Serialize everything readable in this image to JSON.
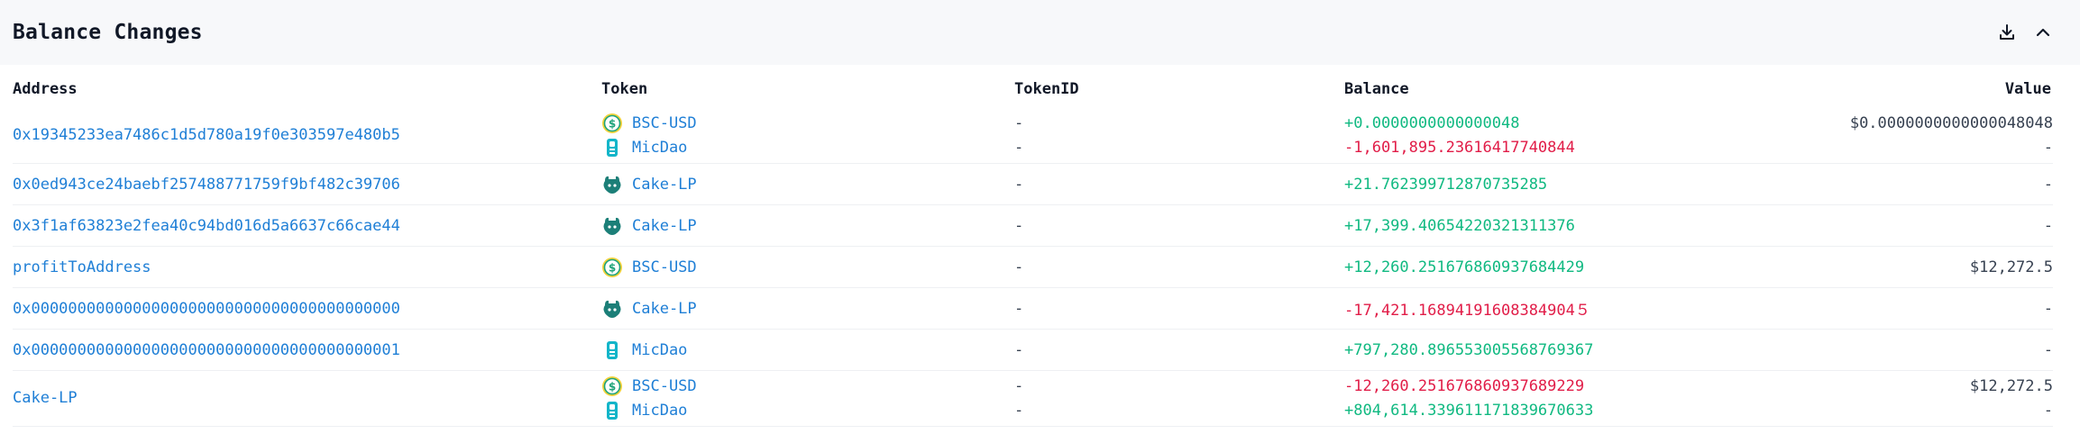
{
  "panel": {
    "title": "Balance Changes",
    "download_icon": "download-icon",
    "collapse_icon": "chevron-up-icon"
  },
  "columns": {
    "address": "Address",
    "token": "Token",
    "token_id": "TokenID",
    "balance": "Balance",
    "value": "Value"
  },
  "colors": {
    "link": "#1f7fd6",
    "positive": "#10b981",
    "negative": "#e11d48"
  },
  "rows": [
    {
      "address": "0x19345233ea7486c1d5d780a19f0e303597e480b5",
      "entries": [
        {
          "token": "BSC-USD",
          "icon": "bsc-usd-coin-icon",
          "token_id": "-",
          "balance": "+0.0000000000000048",
          "sign": "pos",
          "value": "$0.0000000000000048048"
        },
        {
          "token": "MicDao",
          "icon": "micdao-icon",
          "token_id": "-",
          "balance": "-1,601,895.23616417740844",
          "sign": "neg",
          "value": "-"
        }
      ]
    },
    {
      "address": "0x0ed943ce24baebf257488771759f9bf482c39706",
      "entries": [
        {
          "token": "Cake-LP",
          "icon": "cake-lp-icon",
          "token_id": "-",
          "balance": "+21.762399712870735285",
          "sign": "pos",
          "value": "-"
        }
      ]
    },
    {
      "address": "0x3f1af63823e2fea40c94bd016d5a6637c66cae44",
      "entries": [
        {
          "token": "Cake-LP",
          "icon": "cake-lp-icon",
          "token_id": "-",
          "balance": "+17,399.40654220321311376",
          "sign": "pos",
          "value": "-"
        }
      ]
    },
    {
      "address": "profitToAddress",
      "entries": [
        {
          "token": "BSC-USD",
          "icon": "bsc-usd-coin-icon",
          "token_id": "-",
          "balance": "+12,260.251676860937684429",
          "sign": "pos",
          "value": "$12,272.5"
        }
      ]
    },
    {
      "address": "0x0000000000000000000000000000000000000000",
      "entries": [
        {
          "token": "Cake-LP",
          "icon": "cake-lp-icon",
          "token_id": "-",
          "balance": "-17,421.16894191608384904５",
          "sign": "neg",
          "value": "-"
        }
      ]
    },
    {
      "address": "0x0000000000000000000000000000000000000001",
      "entries": [
        {
          "token": "MicDao",
          "icon": "micdao-icon",
          "token_id": "-",
          "balance": "+797,280.896553005568769367",
          "sign": "pos",
          "value": "-"
        }
      ]
    },
    {
      "address": "Cake-LP",
      "entries": [
        {
          "token": "BSC-USD",
          "icon": "bsc-usd-coin-icon",
          "token_id": "-",
          "balance": "-12,260.251676860937689229",
          "sign": "neg",
          "value": "$12,272.5"
        },
        {
          "token": "MicDao",
          "icon": "micdao-icon",
          "token_id": "-",
          "balance": "+804,614.339611171839670633",
          "sign": "pos",
          "value": "-"
        }
      ]
    }
  ]
}
